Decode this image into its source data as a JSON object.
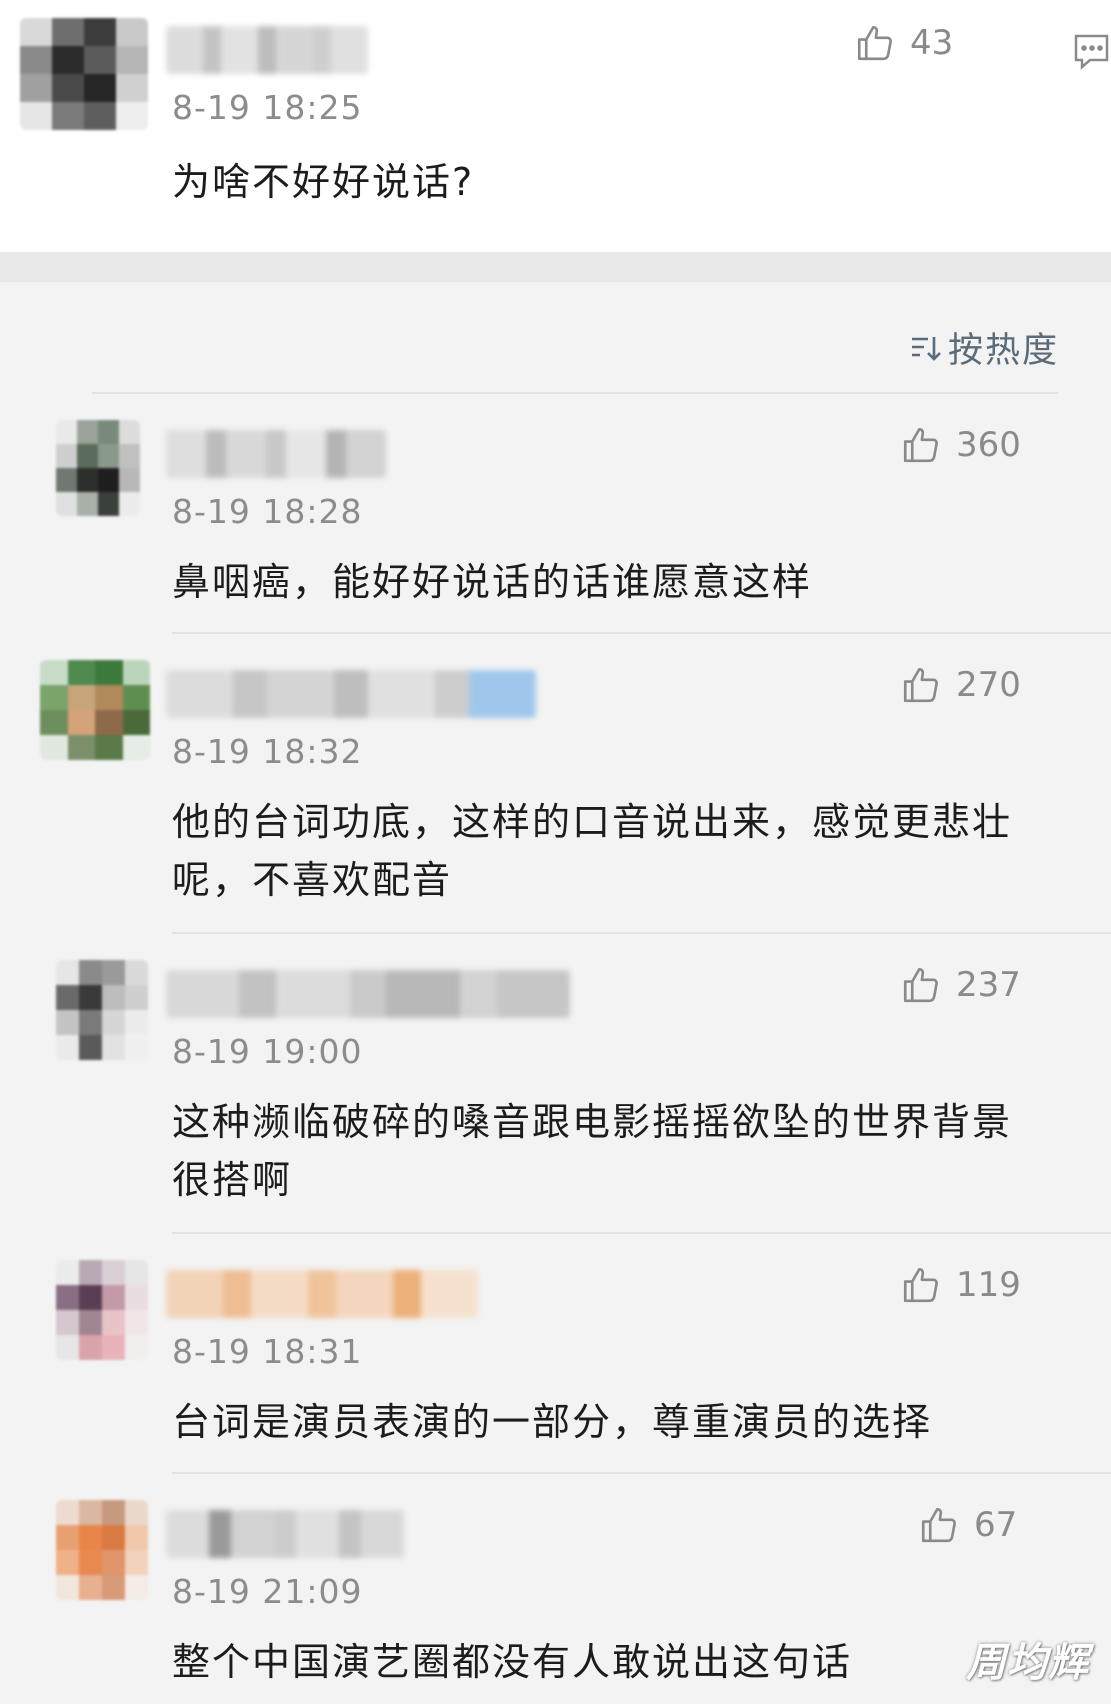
{
  "top_comment": {
    "time": "8-19 18:25",
    "text": "为啥不好好说话?",
    "likes": "43",
    "avatar_colors": [
      "#d9d9d9",
      "#6e6e6e",
      "#3c3c3c",
      "#c9c9c9",
      "#8a8a8a",
      "#2c2c2c",
      "#5b5b5b",
      "#b5b5b5",
      "#a0a0a0",
      "#4a4a4a",
      "#262626",
      "#d0d0d0",
      "#e6e6e6",
      "#7a7a7a",
      "#5e5e5e",
      "#eeeeee"
    ],
    "name_colors": [
      "#dcdcdc",
      "#c4c4c4",
      "#e2e2e2",
      "#bdbdbd",
      "#d6d6d6",
      "#cfcfcf",
      "#e0e0e0"
    ]
  },
  "sort_label": "按热度",
  "replies": [
    {
      "time": "8-19 18:28",
      "lines": [
        "鼻咽癌，能好好说话的话谁愿意这样"
      ],
      "likes": "360",
      "avatar_colors": [
        "#e9e9e9",
        "#9aa39a",
        "#7a8a7a",
        "#dcdcdc",
        "#cfcfcf",
        "#5b6b5b",
        "#8a9a8a",
        "#c0c0c0",
        "#707870",
        "#2b2f2b",
        "#1e1e1e",
        "#b8b8b8",
        "#e0e0e0",
        "#a8b0a8",
        "#3a403a",
        "#ececec"
      ],
      "name_colors": [
        "#dedede",
        "#bcbcbc",
        "#d8d8d8",
        "#c8c8c8",
        "#e6e6e6",
        "#b4b4b4",
        "#d2d2d2"
      ]
    },
    {
      "time": "8-19 18:32",
      "lines": [
        "他的台词功底，这样的口音说出来，感觉更悲壮",
        "呢，不喜欢配音"
      ],
      "likes": "270",
      "avatar_colors": [
        "#c8dcc8",
        "#4f8a4f",
        "#3d7a3d",
        "#bcd4bc",
        "#7aa46a",
        "#c7a47a",
        "#b08a5a",
        "#5f8f4f",
        "#6d8f5d",
        "#d4a37a",
        "#8f6a4a",
        "#4a6a3a",
        "#e0e8e0",
        "#7a8f6a",
        "#5a7a4a",
        "#e6ece6"
      ],
      "name_colors": [
        "#dcdcdc",
        "#c6c6c6",
        "#d4d4d4",
        "#bebebe",
        "#e0e0e0",
        "#cdcdcd",
        "#9fc7ec"
      ]
    },
    {
      "time": "8-19 19:00",
      "lines": [
        "这种濒临破碎的嗓音跟电影摇摇欲坠的世界背景",
        "很搭啊"
      ],
      "likes": "237",
      "avatar_colors": [
        "#e6e6e6",
        "#8a8a8a",
        "#9a9a9a",
        "#dadada",
        "#6a6a6a",
        "#3a3a3a",
        "#bdbdbd",
        "#cfcfcf",
        "#c4c4c4",
        "#7a7a7a",
        "#d6d6d6",
        "#ececec",
        "#eaeaea",
        "#5a5a5a",
        "#e2e2e2",
        "#f0f0f0"
      ],
      "name_colors": [
        "#d8d8d8",
        "#c2c2c2",
        "#dcdcdc",
        "#cacaca",
        "#b8b8b8",
        "#d2d2d2",
        "#c6c6c6"
      ]
    },
    {
      "time": "8-19 18:31",
      "lines": [
        "台词是演员表演的一部分，尊重演员的选择"
      ],
      "likes": "119",
      "avatar_colors": [
        "#ececec",
        "#b9a9b4",
        "#d9d0d5",
        "#e6e6e6",
        "#8a6f84",
        "#5a3f54",
        "#c49aa8",
        "#eadde2",
        "#d4c7cf",
        "#a08592",
        "#e8c4c8",
        "#f0e6e8",
        "#e6e6e6",
        "#d9a3aa",
        "#e8b4ba",
        "#f2eeee"
      ],
      "name_colors": [
        "#f2d3b8",
        "#eebd92",
        "#f5dcc7",
        "#f0c49a",
        "#f3d6bd",
        "#ecb07a",
        "#f6e1cf"
      ]
    },
    {
      "time": "8-19 21:09",
      "lines": [
        "整个中国演艺圈都没有人敢说出这句话"
      ],
      "likes": "67",
      "avatar_colors": [
        "#ecdcd0",
        "#d9b7a0",
        "#c79a7f",
        "#ead8cc",
        "#e8a070",
        "#e8864a",
        "#d97a45",
        "#f0c8aa",
        "#f0b088",
        "#e88a50",
        "#e0956a",
        "#f2d2ba",
        "#f2e6dc",
        "#e8b090",
        "#d89a78",
        "#f4ece6"
      ],
      "name_colors": [
        "#dcdcdc",
        "#9a9a9a",
        "#d2d2d2",
        "#cccccc",
        "#e0e0e0",
        "#c4c4c4",
        "#d8d8d8"
      ]
    }
  ],
  "watermark": "周均辉",
  "colors": {
    "time_text": "#8c8c8c",
    "sort_text": "#5a6b7a",
    "like_icon": "#8a8a8a"
  }
}
